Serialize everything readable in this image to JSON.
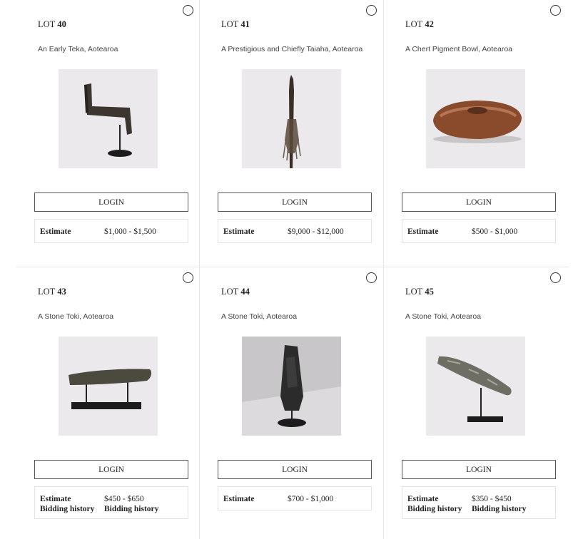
{
  "lots": [
    {
      "lot_prefix": "LOT",
      "lot_number": "40",
      "title": "An Early Teka, Aotearoa",
      "login_label": "LOGIN",
      "estimate_label": "Estimate",
      "estimate_value": "$1,000 - $1,500",
      "bidding_label": "",
      "bidding_value": ""
    },
    {
      "lot_prefix": "LOT",
      "lot_number": "41",
      "title": "A Prestigious and Chiefly Taiaha, Aotearoa",
      "login_label": "LOGIN",
      "estimate_label": "Estimate",
      "estimate_value": "$9,000 - $12,000",
      "bidding_label": "",
      "bidding_value": ""
    },
    {
      "lot_prefix": "LOT",
      "lot_number": "42",
      "title": "A Chert Pigment Bowl, Aotearoa",
      "login_label": "LOGIN",
      "estimate_label": "Estimate",
      "estimate_value": "$500 - $1,000",
      "bidding_label": "",
      "bidding_value": ""
    },
    {
      "lot_prefix": "LOT",
      "lot_number": "43",
      "title": "A Stone Toki, Aotearoa",
      "login_label": "LOGIN",
      "estimate_label": "Estimate",
      "estimate_value": "$450 - $650",
      "bidding_label": "Bidding history",
      "bidding_value": "Bidding history"
    },
    {
      "lot_prefix": "LOT",
      "lot_number": "44",
      "title": "A Stone Toki, Aotearoa",
      "login_label": "LOGIN",
      "estimate_label": "Estimate",
      "estimate_value": "$700 - $1,000",
      "bidding_label": "",
      "bidding_value": ""
    },
    {
      "lot_prefix": "LOT",
      "lot_number": "45",
      "title": "A Stone Toki, Aotearoa",
      "login_label": "LOGIN",
      "estimate_label": "Estimate",
      "estimate_value": "$350 - $450",
      "bidding_label": "Bidding history",
      "bidding_value": "Bidding history"
    }
  ],
  "icons": {
    "select": "radio-circle-icon"
  },
  "colors": {
    "border": "#555555",
    "divider": "#e6e6e6",
    "text": "#222222"
  }
}
